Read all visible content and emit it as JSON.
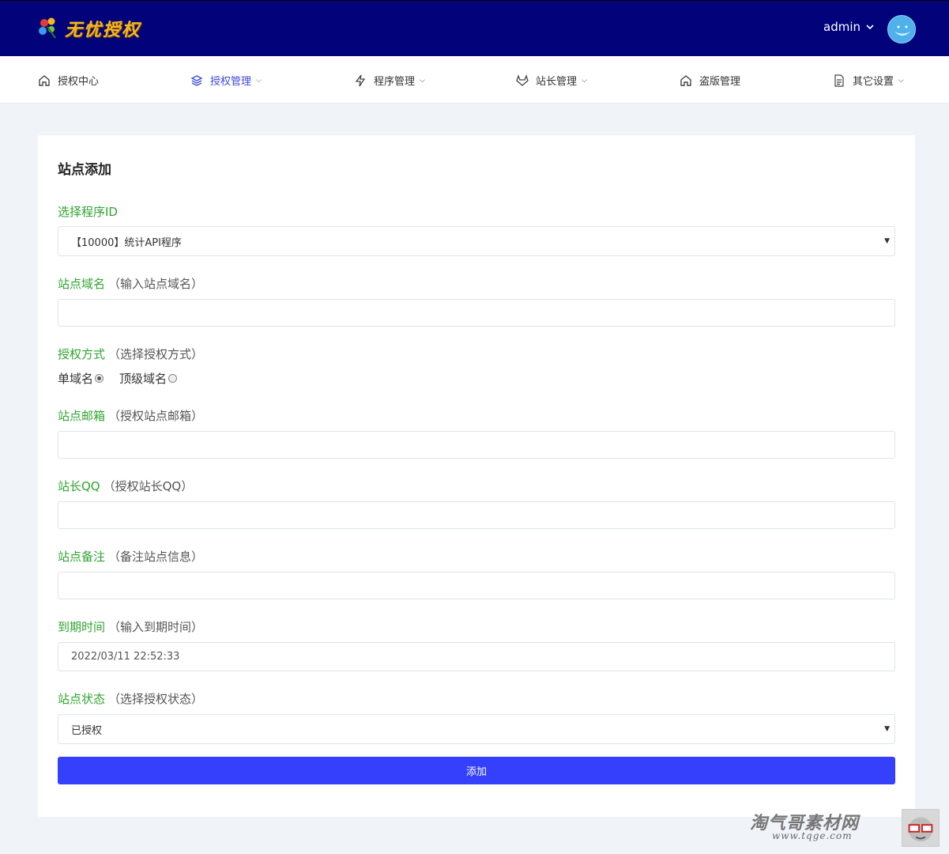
{
  "header": {
    "logo_text": "无忧授权",
    "username": "admin"
  },
  "nav": [
    {
      "label": "授权中心",
      "icon": "home-icon",
      "dropdown": false,
      "active": false
    },
    {
      "label": "授权管理",
      "icon": "layers-icon",
      "dropdown": true,
      "active": true
    },
    {
      "label": "程序管理",
      "icon": "bolt-icon",
      "dropdown": true,
      "active": false
    },
    {
      "label": "站长管理",
      "icon": "gitlab-icon",
      "dropdown": true,
      "active": false
    },
    {
      "label": "盗版管理",
      "icon": "home-icon",
      "dropdown": false,
      "active": false
    },
    {
      "label": "其它设置",
      "icon": "file-icon",
      "dropdown": true,
      "active": false
    }
  ],
  "form": {
    "title": "站点添加",
    "program": {
      "label": "选择程序ID",
      "value": "【10000】统计API程序"
    },
    "domain": {
      "label": "站点域名",
      "hint": "（输入站点域名）",
      "value": ""
    },
    "auth_mode": {
      "label": "授权方式",
      "hint": "（选择授权方式）",
      "options": [
        "单域名",
        "顶级域名"
      ],
      "selected": "单域名"
    },
    "email": {
      "label": "站点邮箱",
      "hint": "（授权站点邮箱）",
      "value": ""
    },
    "qq": {
      "label": "站长QQ",
      "hint": "（授权站长QQ）",
      "value": ""
    },
    "note": {
      "label": "站点备注",
      "hint": "（备注站点信息）",
      "value": ""
    },
    "expire": {
      "label": "到期时间",
      "hint": "（输入到期时间）",
      "value": "2022/03/11 22:52:33"
    },
    "status": {
      "label": "站点状态",
      "hint": "（选择授权状态）",
      "value": "已授权"
    },
    "submit_label": "添加"
  },
  "watermark": {
    "text": "淘气哥素材网",
    "url": "www.tqge.com"
  },
  "colors": {
    "header_bg": "#02027a",
    "label_green": "#2fa52f",
    "button_blue": "#3440fb",
    "active_nav": "#3d4ad8"
  }
}
